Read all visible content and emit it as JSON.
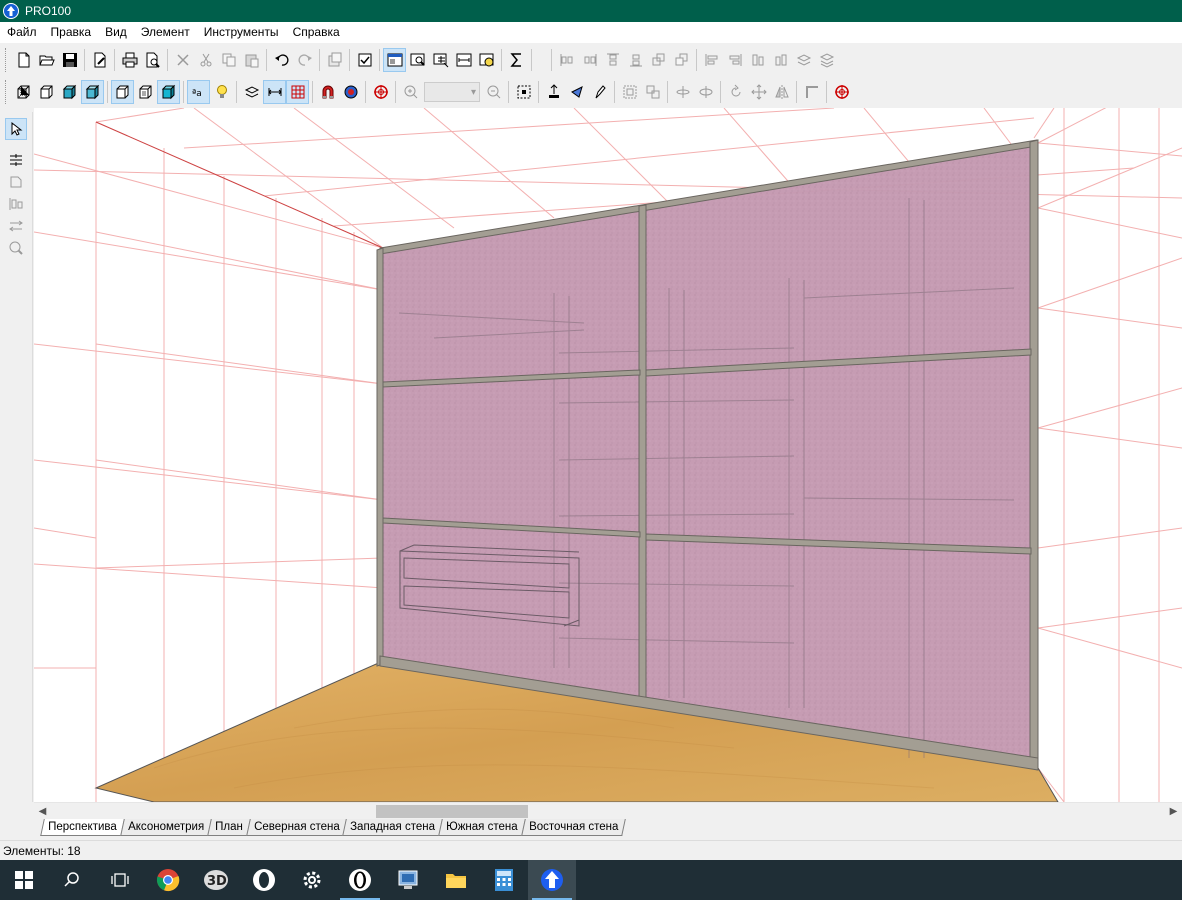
{
  "window": {
    "title": "PRO100"
  },
  "menu": [
    "Файл",
    "Правка",
    "Вид",
    "Элемент",
    "Инструменты",
    "Справка"
  ],
  "tabs": [
    {
      "label": "Перспектива",
      "active": true
    },
    {
      "label": "Аксонометрия",
      "active": false
    },
    {
      "label": "План",
      "active": false
    },
    {
      "label": "Северная стена",
      "active": false
    },
    {
      "label": "Западная стена",
      "active": false
    },
    {
      "label": "Южная стена",
      "active": false
    },
    {
      "label": "Восточная стена",
      "active": false
    }
  ],
  "status": {
    "elements": "Элементы: 18"
  },
  "colors": {
    "titlebar": "#005f4b",
    "door_panel": "#c59ab1",
    "frame": "#a39e93",
    "floor": "#d6a55a",
    "grid_line": "#f3a9a9"
  },
  "taskbar": {
    "apps": [
      "windows-start",
      "search",
      "task-view",
      "chrome",
      "3d-app",
      "opera",
      "settings",
      "opera-gx",
      "network-app",
      "file-explorer",
      "calculator",
      "pro100"
    ]
  }
}
